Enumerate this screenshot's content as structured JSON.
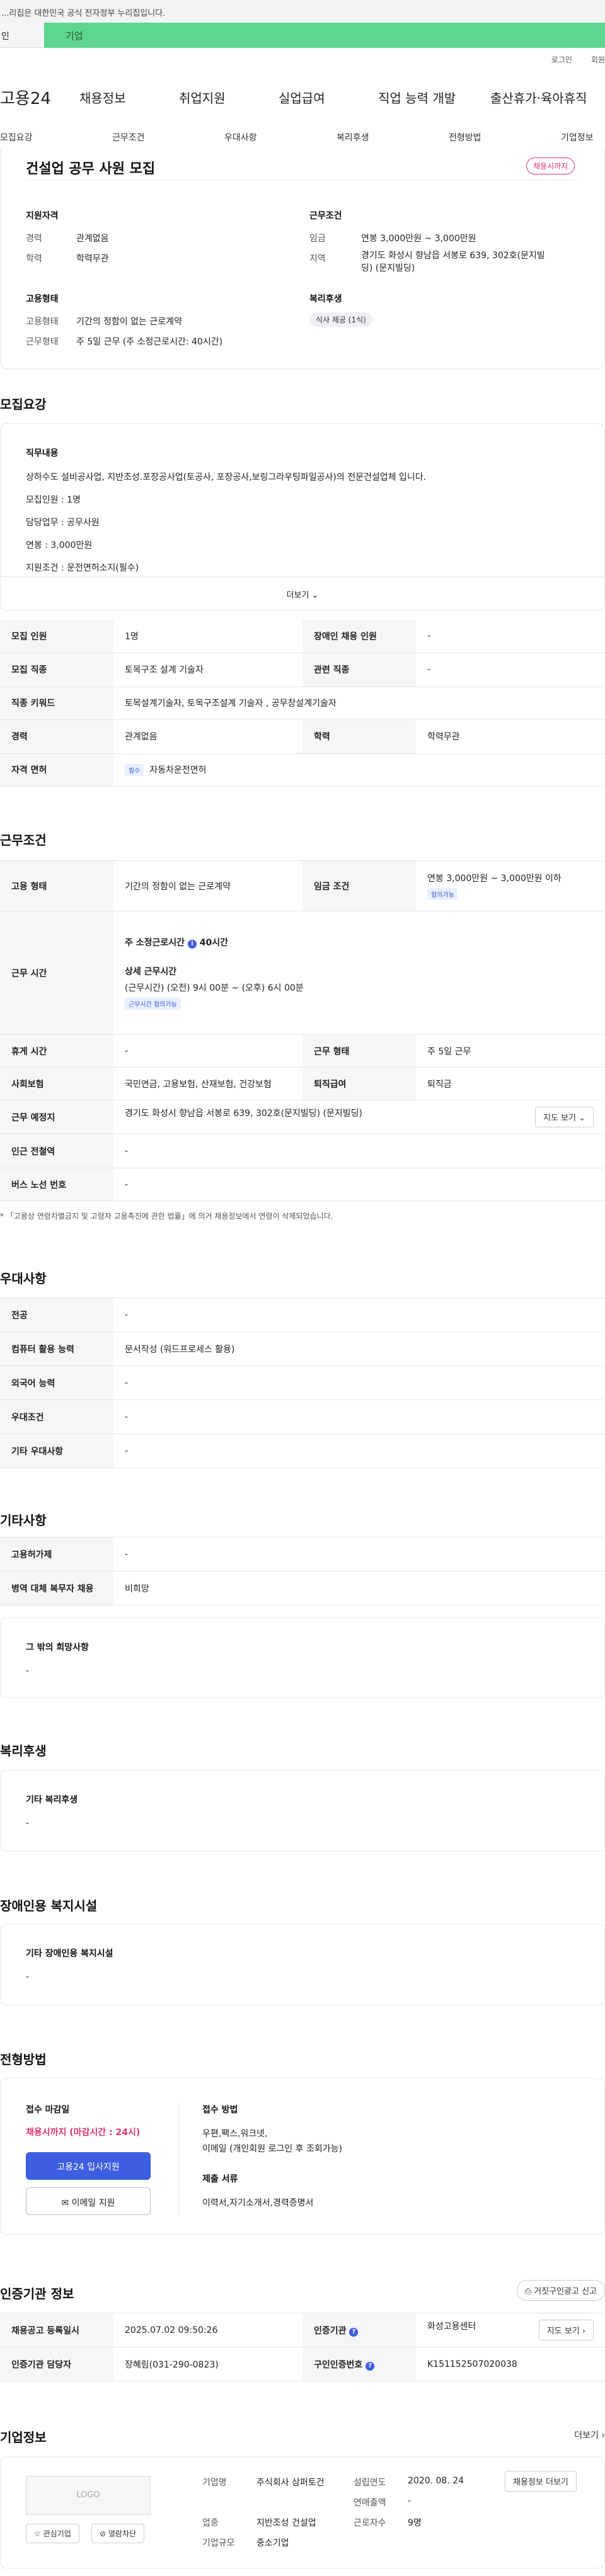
{
  "gov_notice": "이 누리집은 대한민국 공식 전자정부 누리집입니다.",
  "gov_short": "...리집은 대한민국 공식 전자정부 누리집입니다.",
  "tabs": {
    "a": "인",
    "b": "기업"
  },
  "util": {
    "login": "로그인",
    "join": "회원"
  },
  "gnb": {
    "logo": "고용24",
    "menu": [
      "채용정보",
      "취업지원",
      "실업급여",
      "직업 능력 개발",
      "출산휴가·육아휴직"
    ]
  },
  "lnb": [
    "모집요강",
    "근무조건",
    "우대사항",
    "복리후생",
    "전형방법",
    "기업정보"
  ],
  "summary": {
    "title": "건설업 공무 사원 모집",
    "status": "채용시까지",
    "qual_title": "지원자격",
    "exp_label": "경력",
    "exp": "관계없음",
    "edu_label": "학력",
    "edu": "학력무관",
    "work_title": "근무조건",
    "pay_label": "임금",
    "pay": "연봉 3,000만원 ~ 3,000만원",
    "loc_label": "지역",
    "loc": "경기도 화성시 향남읍 서봉로 639, 302호(문지빌딩) (문지빌딩)",
    "emp_title": "고용형태",
    "type_label": "고용형태",
    "type": "기간의 정함이 없는 근로계약",
    "form_label": "근무형태",
    "form": "주 5일 근무 (주 소정근로시간: 40시간)",
    "wel_title": "복리후생",
    "wel_chip": "식사 제공 (1식)"
  },
  "recruit": {
    "title": "모집요강",
    "duty_title": "직무내용",
    "lines": [
      "상하수도 설비공사업, 지반조성.포장공사업(토공사, 포장공사,보링그라우팅파일공사)의 전문건설업체 입니다.",
      "모집인원 : 1명",
      "담당업무 : 공무사원",
      "연봉 : 3,000만원",
      "지원조건 : 운전면허소지(필수)"
    ],
    "more": "더보기 ⌄",
    "rows": {
      "count_l": "모집 인원",
      "count": "1명",
      "dis_l": "장애인 채용 인원",
      "dis": "-",
      "job_l": "모집 직종",
      "job": "토목구조 설계 기술자",
      "rel_l": "관련 직종",
      "rel": "-",
      "kw_l": "직종 키워드",
      "kw": "토목설계기술자, 토목구조설계 기술자 , 공무창설계기술자",
      "exp_l": "경력",
      "exp": "관계없음",
      "edu_l": "학력",
      "edu": "학력무관",
      "lic_l": "자격 면허",
      "lic_tag": "필수",
      "lic": "자동차운전면허"
    }
  },
  "work": {
    "title": "근무조건",
    "emp_l": "고용 형태",
    "emp": "기간의 정함이 없는 근로계약",
    "pay_l": "임금 조건",
    "pay": "연봉 3,000만원 ~ 3,000만원 이하",
    "pay_tag": "협의가능",
    "time_l": "근무 시간",
    "time_head": "주 소정근로시간",
    "time_hours": "40시간",
    "time_detail_t": "상세 근무시간",
    "time_detail": "(근무시간) (오전) 9시 00분 ~ (오후) 6시 00분",
    "time_tag": "근무시간 협의가능",
    "rest_l": "휴게 시간",
    "rest": "-",
    "shape_l": "근무 형태",
    "shape": "주 5일 근무",
    "ins_l": "사회보험",
    "ins": "국민연금, 고용보험, 산재보험, 건강보험",
    "ret_l": "퇴직급여",
    "ret": "퇴직금",
    "place_l": "근무 예정지",
    "place": "경기도 화성시 향남읍 서봉로 639, 302호(문지빌딩) (문지빌딩)",
    "map_btn": "지도 보기 ⌄",
    "sub_l": "인근 전철역",
    "sub": "-",
    "bus_l": "버스 노선 번호",
    "bus": "-",
    "note": "* 「고용상 연령차별금지 및 고령자 고용촉진에 관한 법률」에 의거 채용정보에서 연령이 삭제되었습니다."
  },
  "pref": {
    "title": "우대사항",
    "major_l": "전공",
    "major": "-",
    "pc_l": "컴퓨터 활용 능력",
    "pc": "문서작성 (워드프로세스 활용)",
    "lang_l": "외국어 능력",
    "lang": "-",
    "cond_l": "우대조건",
    "cond": "-",
    "etc_l": "기타 우대사항",
    "etc": "-"
  },
  "other": {
    "title": "기타사항",
    "plan_l": "고용허가제",
    "plan": "-",
    "mil_l": "병역 대체 복무자 채용",
    "mil": "비희망",
    "wish_t": "그 밖의 희망사항",
    "wish": "-"
  },
  "welfare": {
    "title": "복리후생",
    "box_t": "기타 복리후생",
    "box": "-"
  },
  "disab": {
    "title": "장애인용 복지시설",
    "box_t": "기타 장애인용 복지시설",
    "box": "-"
  },
  "proc": {
    "title": "전형방법",
    "deadline_t": "접수 마감일",
    "deadline": "채용시까지 (마감시간 : 24시)",
    "apply_btn": "고용24 입사지원",
    "email_btn": "이메일 지원",
    "method_t": "접수 방법",
    "method": "우편,팩스,워크넷,",
    "method2": "이메일 (개인회원 로그인 후 조회가능)",
    "docs_t": "제출 서류",
    "docs": "이력서,자기소개서,경력증명서"
  },
  "cert": {
    "title": "인증기관 정보",
    "report_btn": "거짓구인광고 신고",
    "reg_l": "채용공고 등록일시",
    "reg": "2025.07.02 09:50:26",
    "org_l": "인증기관",
    "org": "화성고용센터",
    "map_btn": "지도 보기 ›",
    "mgr_l": "인증기관 담당자",
    "mgr": "장혜림(031-290-0823)",
    "no_l": "구인인증번호",
    "no": "K151152507020038"
  },
  "company": {
    "title": "기업정보",
    "more": "더보기 ›",
    "logo": "LOGO",
    "fav": "☆ 관심기업",
    "block": "열람차단",
    "name_l": "기업명",
    "name": "주식회사 삼퍼토건",
    "ind_l": "업종",
    "ind": "지반조성 건설업",
    "size_l": "기업규모",
    "size": "중소기업",
    "est_l": "설립연도",
    "est": "2020. 08. 24",
    "sales_l": "연매출액",
    "sales": "-",
    "emp_l": "근로자수",
    "emp": "9명",
    "jobs_btn": "채용정보 더보기"
  },
  "colors": {
    "green": "#5ed68f",
    "blue": "#3d5ee1",
    "pink": "#e0336b"
  }
}
